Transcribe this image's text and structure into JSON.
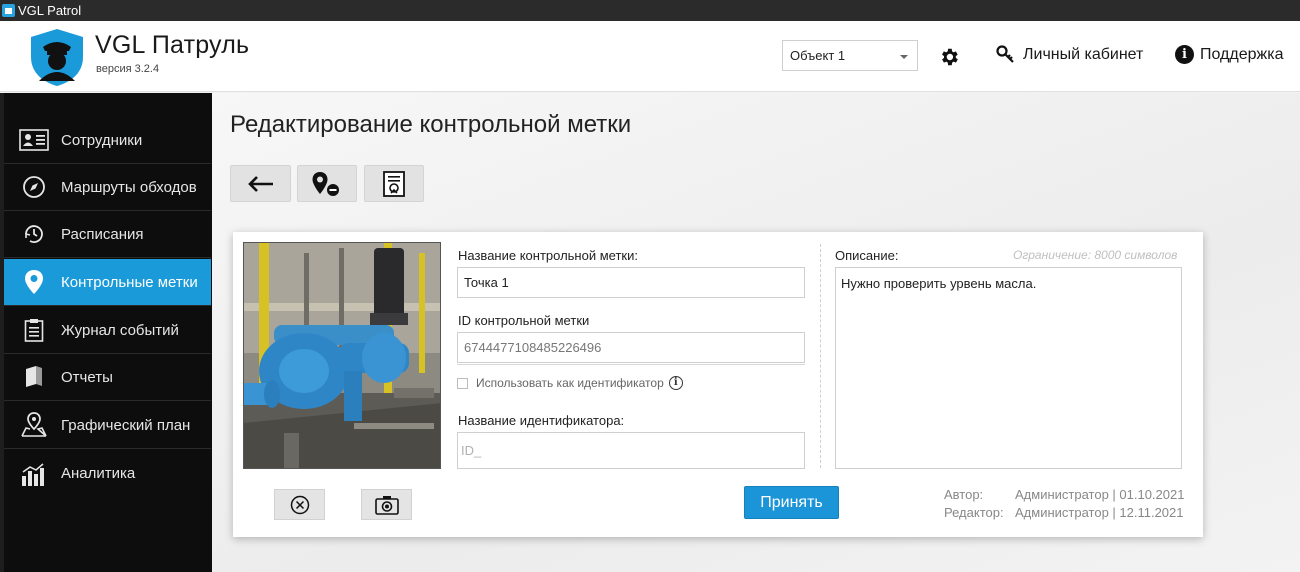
{
  "window": {
    "title": "VGL Patrol"
  },
  "header": {
    "brand": "VGL Патруль",
    "version": "версия 3.2.4",
    "object_select": "Объект 1",
    "cabinet": "Личный кабинет",
    "support": "Поддержка"
  },
  "sidebar": {
    "items": [
      {
        "label": "Сотрудники",
        "icon": "id-card-icon"
      },
      {
        "label": "Маршруты обходов",
        "icon": "compass-icon"
      },
      {
        "label": "Расписания",
        "icon": "clock-icon"
      },
      {
        "label": "Контрольные метки",
        "icon": "map-pin-icon",
        "active": true
      },
      {
        "label": "Журнал событий",
        "icon": "clipboard-icon"
      },
      {
        "label": "Отчеты",
        "icon": "book-icon"
      },
      {
        "label": "Графический план",
        "icon": "map-location-icon"
      },
      {
        "label": "Аналитика",
        "icon": "bar-chart-icon"
      }
    ]
  },
  "main": {
    "title": "Редактирование контрольной метки",
    "toolbar": [
      "back-arrow-icon",
      "pin-remove-icon",
      "document-icon"
    ],
    "form": {
      "name_label": "Название контрольной метки:",
      "name_value": "Точка 1",
      "id_label": "ID контрольной метки",
      "id_value": "6744477108485226496",
      "use_as_identifier": "Использовать как идентификатор",
      "identifier_label": "Название идентификатора:",
      "identifier_placeholder": "ID_",
      "description_label": "Описание:",
      "description_limit": "Ограничение: 8000 символов",
      "description_value": "Нужно проверить урвень масла.",
      "accept": "Принять",
      "author_label": "Автор:",
      "author_value": "Администратор | 01.10.2021",
      "editor_label": "Редактор:",
      "editor_value": "Администратор | 12.11.2021"
    }
  },
  "colors": {
    "accent": "#1a9ad9",
    "sidebar_bg": "#0d0d0d",
    "titlebar_bg": "#2b2b2b"
  }
}
